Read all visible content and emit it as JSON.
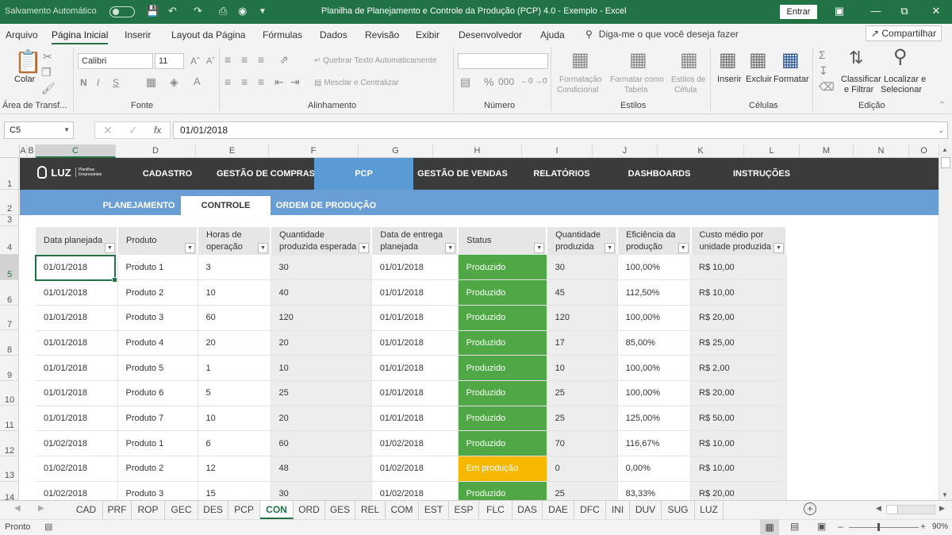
{
  "titlebar": {
    "autosave_label": "Salvamento Automático",
    "title": "Planilha de Planejamento e Controle da Produção (PCP) 4.0 - Exemplo  -  Excel",
    "signin": "Entrar"
  },
  "menu": {
    "items": [
      "Arquivo",
      "Página Inicial",
      "Inserir",
      "Layout da Página",
      "Fórmulas",
      "Dados",
      "Revisão",
      "Exibir",
      "Desenvolvedor",
      "Ajuda"
    ],
    "tell_me": "Diga-me o que você deseja fazer",
    "share": "Compartilhar"
  },
  "ribbon": {
    "paste": "Colar",
    "clipboard_group": "Área de Transf...",
    "font_name": "Calibri",
    "font_size": "11",
    "font_group": "Fonte",
    "wrap_text": "Quebrar Texto Automaticamente",
    "merge_center": "Mesclar e Centralizar",
    "alignment_group": "Alinhamento",
    "number_group": "Número",
    "cond_format_1": "Formatação",
    "cond_format_2": "Condicional",
    "format_table_1": "Formatar como",
    "format_table_2": "Tabela",
    "cell_styles_1": "Estilos de",
    "cell_styles_2": "Célula",
    "styles_group": "Estilos",
    "insert": "Inserir",
    "delete": "Excluir",
    "format": "Formatar",
    "cells_group": "Células",
    "sort_1": "Classificar",
    "sort_2": "e Filtrar",
    "find_1": "Localizar e",
    "find_2": "Selecionar",
    "editing_group": "Edição"
  },
  "formula_bar": {
    "name_box": "C5",
    "value": "01/01/2018"
  },
  "columns": [
    "A",
    "B",
    "C",
    "D",
    "E",
    "F",
    "G",
    "H",
    "I",
    "J",
    "K",
    "L",
    "M",
    "N",
    "O"
  ],
  "rows": [
    "1",
    "2",
    "3",
    "4",
    "5",
    "6",
    "7",
    "8",
    "9",
    "10",
    "11",
    "12",
    "13",
    "14"
  ],
  "app_nav": {
    "logo": "LUZ",
    "logo_sub": "Planilhas Empresariais",
    "items": [
      "CADASTRO",
      "GESTÃO DE COMPRAS",
      "PCP",
      "GESTÃO DE VENDAS",
      "RELATÓRIOS",
      "DASHBOARDS",
      "INSTRUÇÕES"
    ],
    "subitems": [
      "PLANEJAMENTO",
      "CONTROLE",
      "ORDEM DE PRODUÇÃO"
    ]
  },
  "table": {
    "headers": [
      [
        "Data planejada",
        ""
      ],
      [
        "Produto",
        ""
      ],
      [
        "Horas de",
        "operação"
      ],
      [
        "Quantidade",
        "produzida esperada"
      ],
      [
        "Data de entrega",
        "planejada"
      ],
      [
        "Status",
        ""
      ],
      [
        "Quantidade",
        "produzida"
      ],
      [
        "Eficiência da",
        "produção"
      ],
      [
        "Custo médio por",
        "unidade produzida"
      ]
    ],
    "rows": [
      [
        "01/01/2018",
        "Produto 1",
        "3",
        "30",
        "01/01/2018",
        "Produzido",
        "30",
        "100,00%",
        "R$ 10,00"
      ],
      [
        "01/01/2018",
        "Produto 2",
        "10",
        "40",
        "01/01/2018",
        "Produzido",
        "45",
        "112,50%",
        "R$ 10,00"
      ],
      [
        "01/01/2018",
        "Produto 3",
        "60",
        "120",
        "01/01/2018",
        "Produzido",
        "120",
        "100,00%",
        "R$ 20,00"
      ],
      [
        "01/01/2018",
        "Produto 4",
        "20",
        "20",
        "01/01/2018",
        "Produzido",
        "17",
        "85,00%",
        "R$ 25,00"
      ],
      [
        "01/01/2018",
        "Produto 5",
        "1",
        "10",
        "01/01/2018",
        "Produzido",
        "10",
        "100,00%",
        "R$ 2,00"
      ],
      [
        "01/01/2018",
        "Produto 6",
        "5",
        "25",
        "01/01/2018",
        "Produzido",
        "25",
        "100,00%",
        "R$ 20,00"
      ],
      [
        "01/01/2018",
        "Produto 7",
        "10",
        "20",
        "01/01/2018",
        "Produzido",
        "25",
        "125,00%",
        "R$ 50,00"
      ],
      [
        "01/02/2018",
        "Produto 1",
        "6",
        "60",
        "01/02/2018",
        "Produzido",
        "70",
        "116,67%",
        "R$ 10,00"
      ],
      [
        "01/02/2018",
        "Produto 2",
        "12",
        "48",
        "01/02/2018",
        "Em produção",
        "0",
        "0,00%",
        "R$ 10,00"
      ],
      [
        "01/02/2018",
        "Produto 3",
        "15",
        "30",
        "01/02/2018",
        "Produzido",
        "25",
        "83,33%",
        "R$ 20,00"
      ]
    ],
    "status_colors": {
      "Produzido": "#4fa845",
      "Em produção": "#f7b900"
    }
  },
  "sheet_tabs": [
    "CAD",
    "PRF",
    "ROP",
    "GEC",
    "DES",
    "PCP",
    "CON",
    "ORD",
    "GES",
    "REL",
    "COM",
    "EST",
    "ESP",
    "FLC",
    "DAS",
    "DAE",
    "DFC",
    "INI",
    "DUV",
    "SUG",
    "LUZ"
  ],
  "active_tab": "CON",
  "status": {
    "ready": "Pronto",
    "zoom": "90%"
  }
}
